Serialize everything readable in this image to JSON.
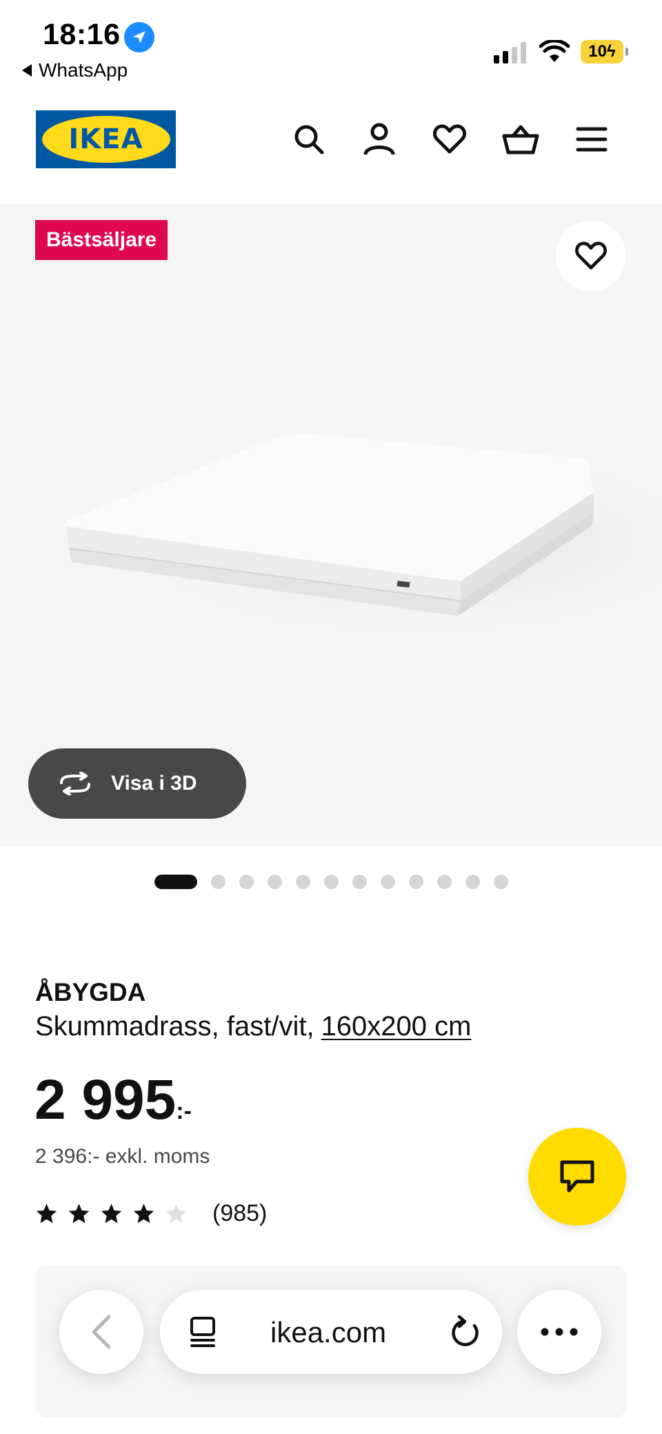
{
  "status_bar": {
    "time": "18:16",
    "back_app": "WhatsApp",
    "battery": "10"
  },
  "header": {
    "logo_text": "IKEA",
    "icons": [
      "search-icon",
      "account-icon",
      "heart-icon",
      "cart-icon",
      "menu-icon"
    ]
  },
  "gallery": {
    "badge": "Bästsäljare",
    "view_3d_label": "Visa i 3D",
    "image_count": 12,
    "active_index": 0
  },
  "product": {
    "name": "ÅBYGDA",
    "description": "Skummadrass, fast/vit,",
    "size": "160x200 cm",
    "price": "2 995",
    "price_suffix": ":-",
    "price_excl_vat": "2 396:- exkl. moms",
    "rating": 4,
    "rating_max": 5,
    "review_count": "(985)"
  },
  "browser": {
    "url": "ikea.com"
  },
  "colors": {
    "ikea_blue": "#0058a3",
    "ikea_yellow": "#ffdb00",
    "badge_red": "#e00751"
  }
}
